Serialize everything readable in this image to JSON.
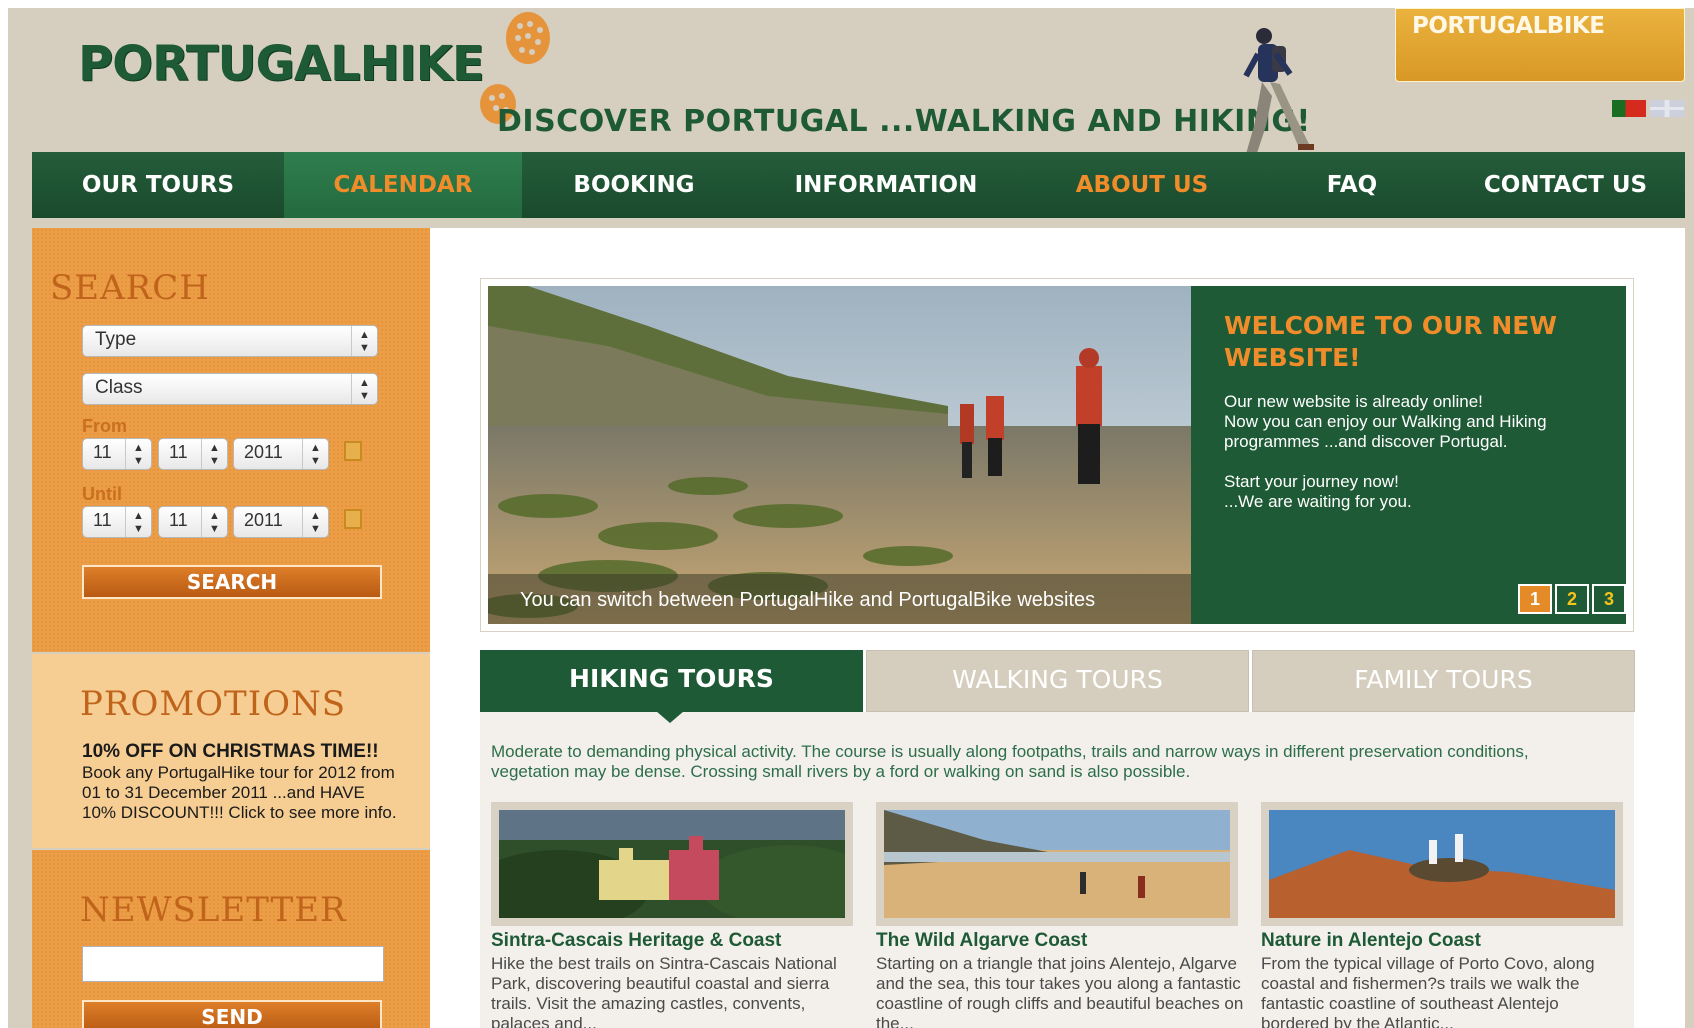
{
  "header": {
    "logo": "PORTUGALHIKE",
    "tagline": "DISCOVER PORTUGAL  ...WALKING AND HIKING!",
    "bike_badge": "PORTUGALBIKE"
  },
  "languages": [
    "Portuguese",
    "English"
  ],
  "nav": {
    "items": [
      {
        "label": "OUR TOURS"
      },
      {
        "label": "CALENDAR"
      },
      {
        "label": "BOOKING"
      },
      {
        "label": "INFORMATION"
      },
      {
        "label": "ABOUT US"
      },
      {
        "label": "FAQ"
      },
      {
        "label": "CONTACT US"
      }
    ]
  },
  "search": {
    "heading": "SEARCH",
    "type_select": "Type",
    "class_select": "Class",
    "from_label": "From",
    "from": {
      "day": "11",
      "month": "11",
      "year": "2011"
    },
    "until_label": "Until",
    "until": {
      "day": "11",
      "month": "11",
      "year": "2011"
    },
    "button": "SEARCH"
  },
  "promotions": {
    "heading": "PROMOTIONS",
    "title": "10% OFF ON CHRISTMAS TIME!!",
    "text": "Book any PortugalHike tour for 2012 from 01 to 31 December 2011 ...and HAVE 10% DISCOUNT!!! Click to see more info."
  },
  "newsletter": {
    "heading": "NEWSLETTER",
    "input_value": "",
    "button": "SEND"
  },
  "slider": {
    "caption": "You can switch between PortugalHike and PortugalBike websites",
    "welcome_title": "WELCOME TO OUR NEW WEBSITE!",
    "welcome_line1": "Our new website is already online!",
    "welcome_line2": "Now you can enjoy our Walking and Hiking programmes ...and discover Portugal.",
    "welcome_line3": "Start your journey now!",
    "welcome_line4": "...We are waiting for you.",
    "pages": [
      "1",
      "2",
      "3"
    ],
    "active_page": "1"
  },
  "tabs": {
    "items": [
      {
        "label": "HIKING TOURS"
      },
      {
        "label": "WALKING TOURS"
      },
      {
        "label": "FAMILY TOURS"
      }
    ],
    "active": "HIKING TOURS",
    "description": "Moderate to demanding physical activity. The course is usually along footpaths, trails and narrow ways in different preservation conditions, vegetation may be dense.  Crossing small rivers by a ford or walking on sand is also possible."
  },
  "tours": [
    {
      "title": "Sintra-Cascais Heritage & Coast",
      "text": "Hike the best trails on Sintra-Cascais National Park, discovering beautiful coastal and sierra trails. Visit the amazing castles, convents, palaces and..."
    },
    {
      "title": "The Wild Algarve Coast",
      "text": "Starting on a triangle that joins Alentejo, Algarve and the sea, this tour takes you along a fantastic coastline of rough cliffs and beautiful beaches on the..."
    },
    {
      "title": "Nature in Alentejo Coast",
      "text": "From the typical village of Porto Covo, along coastal and fishermen?s trails we walk the fantastic coastline of southeast Alentejo bordered by the Atlantic..."
    }
  ],
  "colors": {
    "brand_green": "#1e5a36",
    "accent_orange": "#f08c2a",
    "sidebar_orange": "#ec9d47",
    "page_beige": "#d6cfbf"
  }
}
